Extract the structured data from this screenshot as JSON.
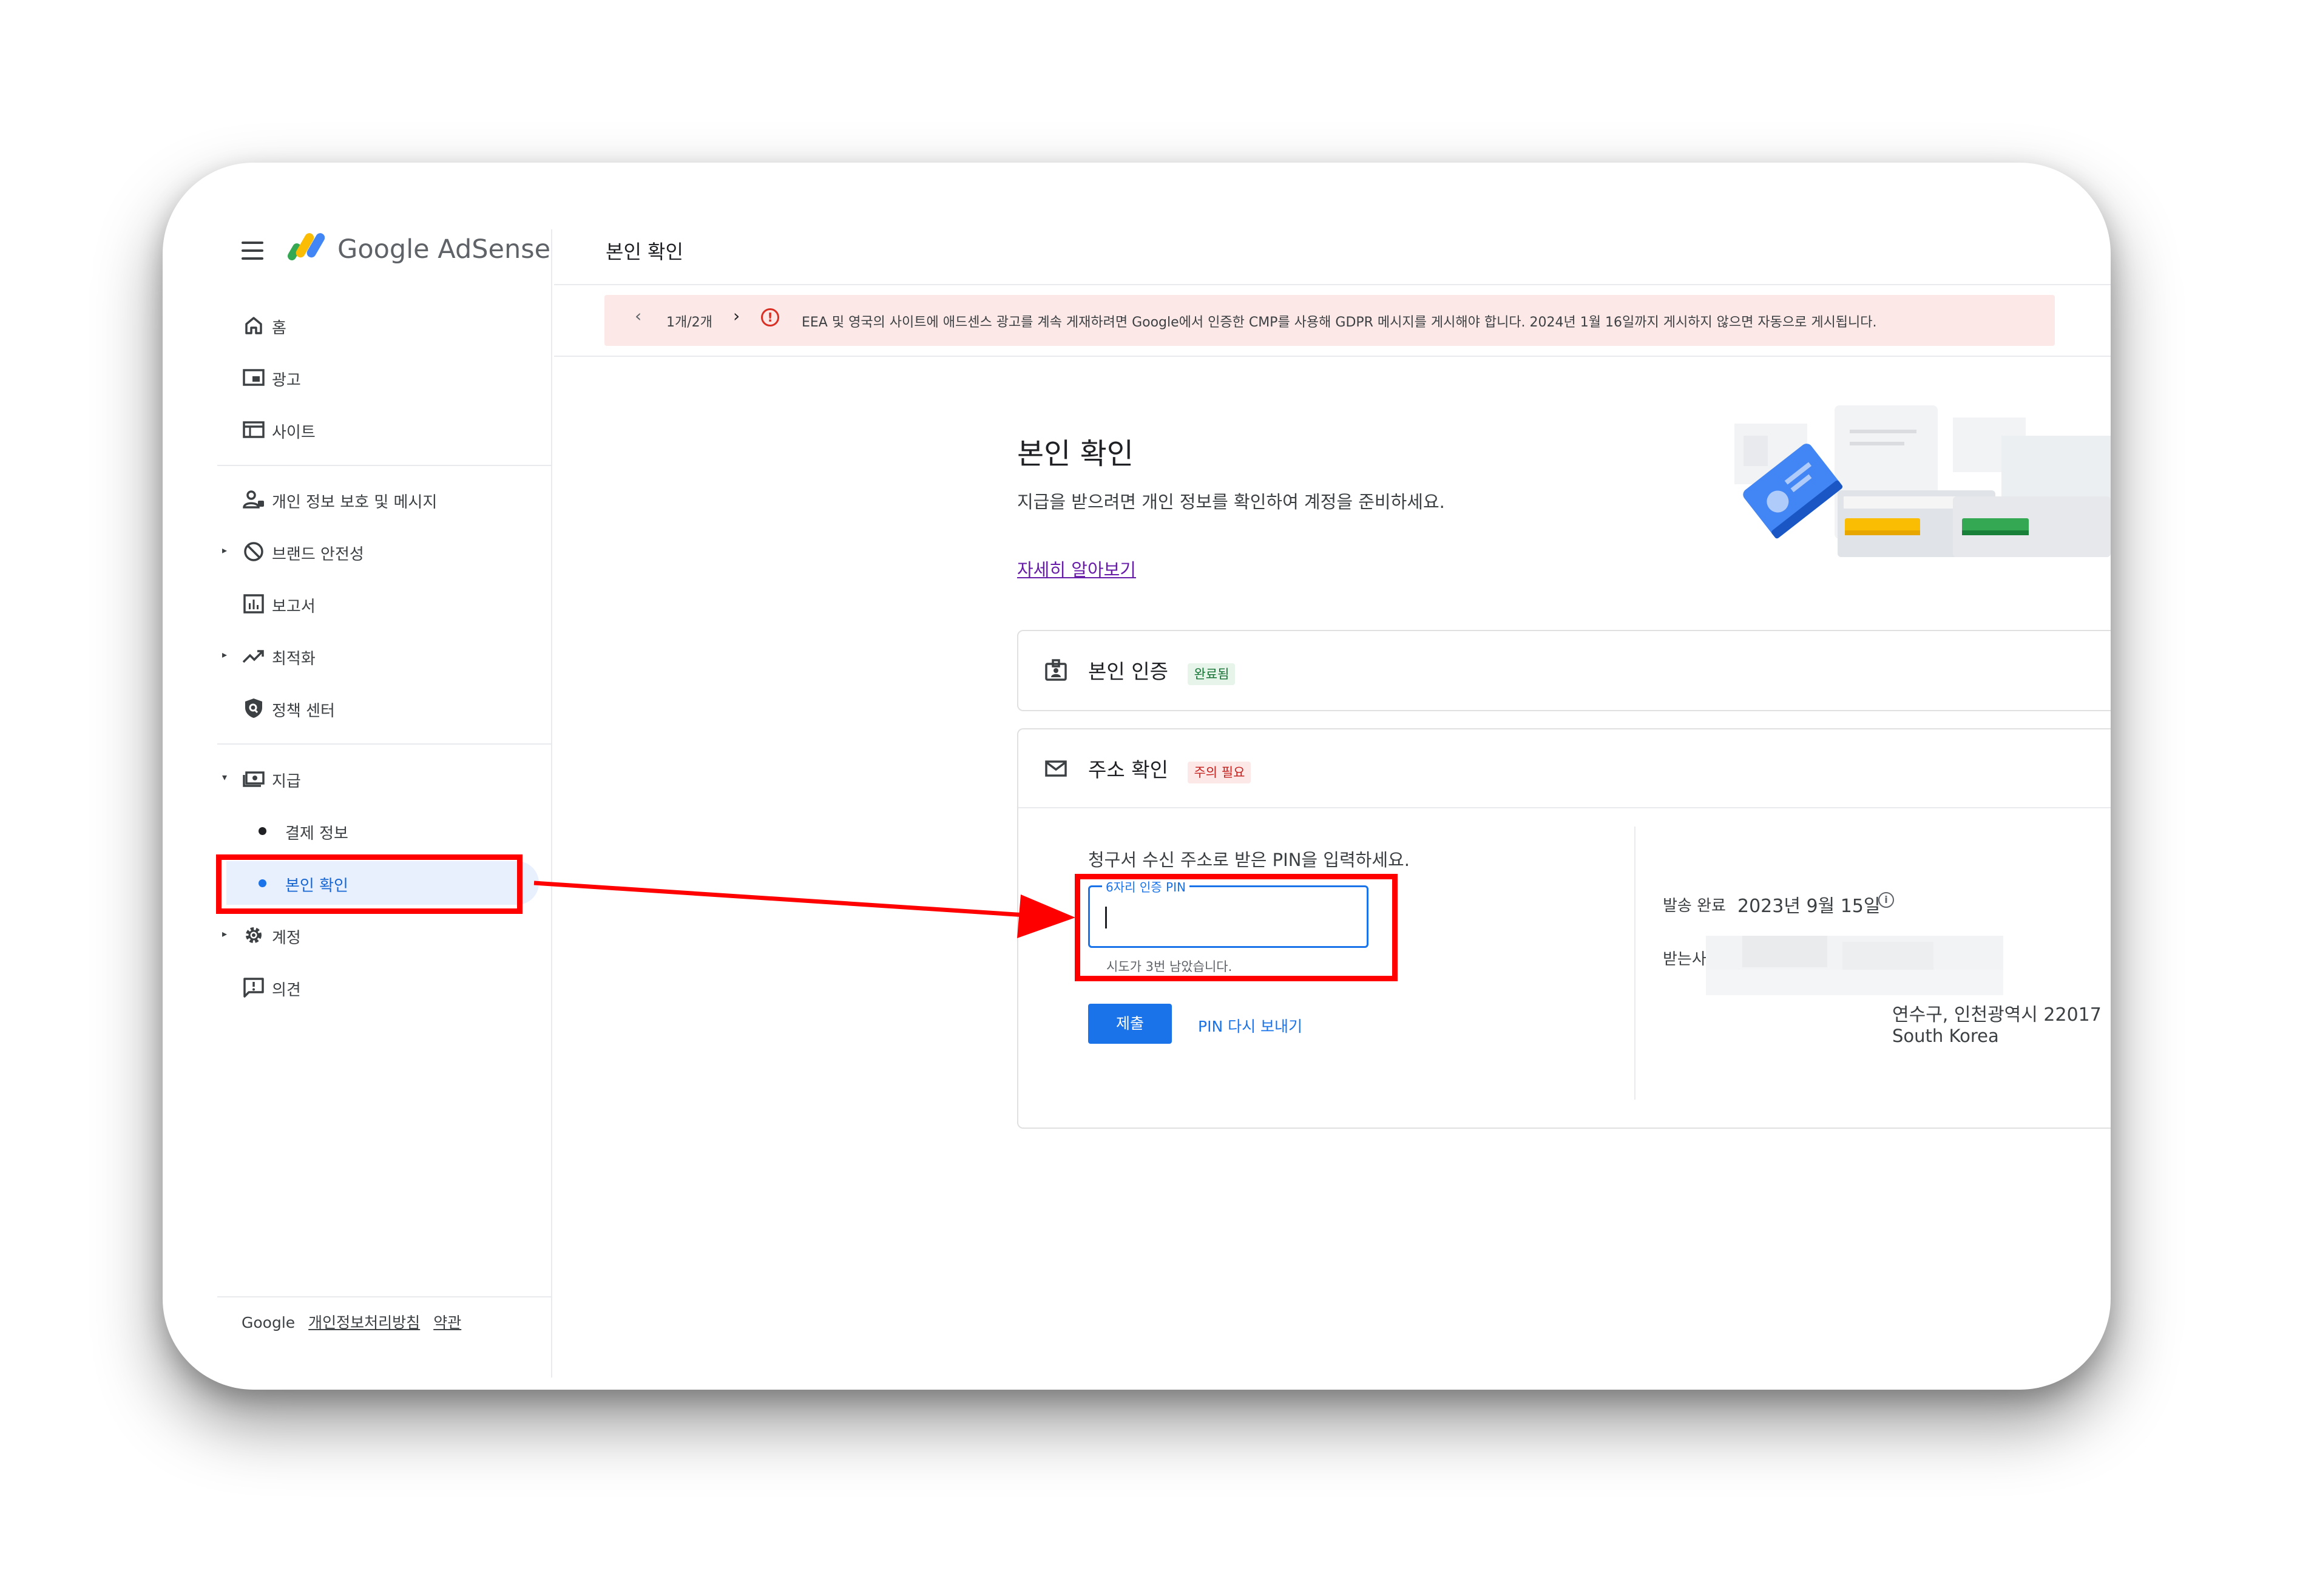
{
  "header": {
    "app_title": "Google AdSense",
    "page_title": "본인 확인"
  },
  "banner": {
    "counter": "1개/2개",
    "message": "EEA 및 영국의 사이트에 애드센스 광고를 계속 게재하려면 Google에서 인증한 CMP를 사용해 GDPR 메시지를 게시해야 합니다. 2024년 1월 16일까지 게시하지 않으면 자동으로 게시됩니다."
  },
  "sidebar": {
    "home": "홈",
    "ads": "광고",
    "sites": "사이트",
    "privacy": "개인 정보 보호 및 메시지",
    "brand_safety": "브랜드 안전성",
    "reports": "보고서",
    "optimization": "최적화",
    "policy_center": "정책 센터",
    "payments": "지급",
    "payment_info": "결제 정보",
    "verification": "본인 확인",
    "account": "계정",
    "feedback": "의견"
  },
  "footer": {
    "google": "Google",
    "privacy_policy": "개인정보처리방침",
    "terms": "약관"
  },
  "main": {
    "title": "본인 확인",
    "description": "지급을 받으려면 개인 정보를 확인하여 계정을 준비하세요.",
    "learn_more": "자세히 알아보기",
    "identity": {
      "title": "본인 인증",
      "badge": "완료됨"
    },
    "address": {
      "title": "주소 확인",
      "badge": "주의 필요",
      "pin_prompt": "청구서 수신 주소로 받은 PIN을 입력하세요.",
      "pin_label": "6자리 인증 PIN",
      "pin_value": "",
      "pin_helper": "시도가 3번 남았습니다.",
      "submit": "제출",
      "resend": "PIN 다시 보내기",
      "sent_label": "발송 완료",
      "sent_date": "2023년 9월 15일",
      "recipient_label": "받는사람",
      "address_line": "연수구, 인천광역시 22017",
      "country": "South Korea"
    }
  },
  "colors": {
    "accent": "#1a73e8",
    "annotation": "#ff0000",
    "banner_bg": "#fce8e6",
    "active_bg": "#e8f0fe"
  },
  "icons": {
    "menu": "hamburger-icon",
    "logo": "adsense-logo-icon",
    "home": "home-icon",
    "ads": "ads-icon",
    "sites": "sites-icon",
    "privacy": "privacy-person-icon",
    "brand_safety": "block-icon",
    "reports": "bar-chart-icon",
    "optimization": "trending-up-icon",
    "policy": "shield-search-icon",
    "payments": "payments-icon",
    "account": "gear-icon",
    "feedback": "feedback-icon",
    "identity": "id-card-icon",
    "address": "mail-icon",
    "info": "info-icon",
    "error": "error-icon"
  }
}
